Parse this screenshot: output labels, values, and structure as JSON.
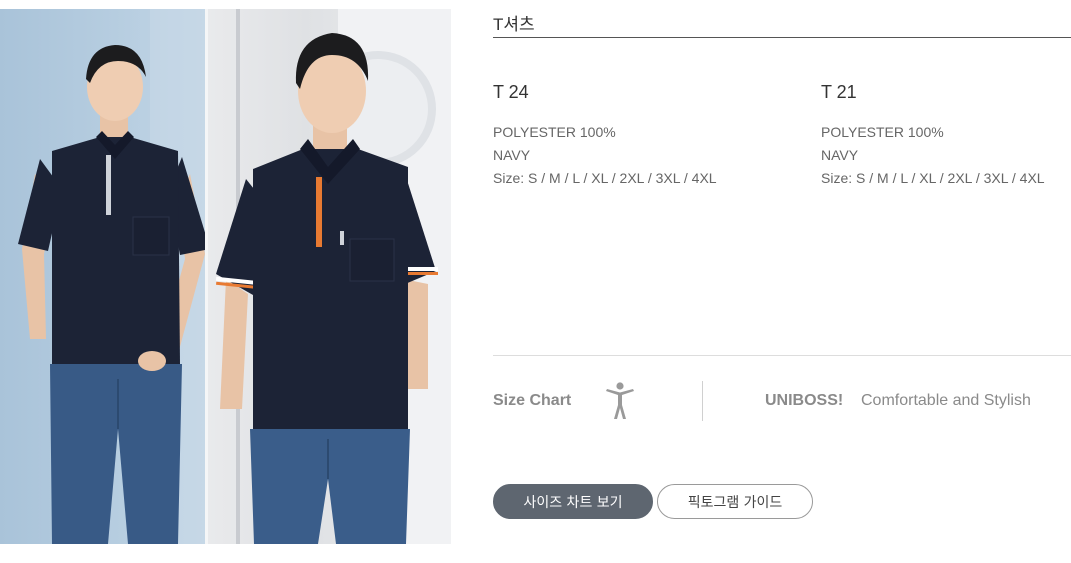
{
  "section": {
    "title": "T셔츠"
  },
  "products": [
    {
      "code": "T 24",
      "material": "POLYESTER 100%",
      "color": "NAVY",
      "sizes": "Size: S / M / L / XL / 2XL / 3XL / 4XL"
    },
    {
      "code": "T 21",
      "material": "POLYESTER 100%",
      "color": "NAVY",
      "sizes": "Size: S / M / L / XL / 2XL / 3XL / 4XL"
    }
  ],
  "info_bar": {
    "size_chart_label": "Size Chart",
    "icon": "person-standing-icon",
    "brand": "UNIBOSS!",
    "tagline": "Comfortable and Stylish"
  },
  "buttons": {
    "size_chart": "사이즈 차트 보기",
    "pictogram_guide": "픽토그램 가이드"
  },
  "colors": {
    "button_primary": "#5e6670",
    "shirt_navy": "#1c2336",
    "accent_orange": "#e87a32"
  }
}
